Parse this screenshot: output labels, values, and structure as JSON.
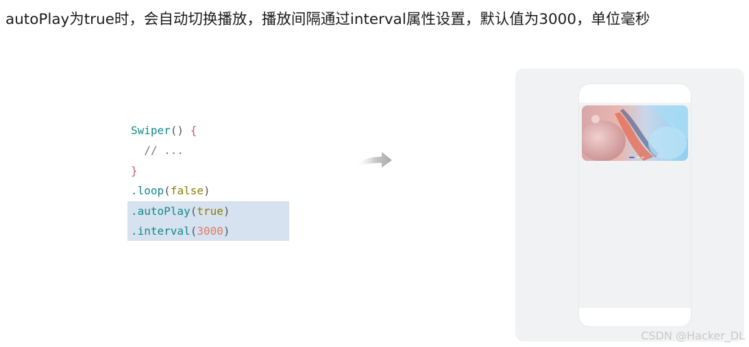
{
  "headline": "autoPlay为true时，会自动切换播放，播放间隔通过interval属性设置，默认值为3000，单位毫秒",
  "code": {
    "line1_fn": "Swiper",
    "line1_paren": "() ",
    "line1_brace": "{",
    "line2_comment": "  // ...",
    "line3_brace": "}",
    "line4_method": ".loop",
    "line4_arg": "false",
    "line5_method": ".autoPlay",
    "line5_arg": "true",
    "line6_method": ".interval",
    "line6_arg": "3000"
  },
  "preview": {
    "carousel_pages": 3,
    "active_page": 1
  },
  "watermark": "CSDN @Hacker_DL"
}
